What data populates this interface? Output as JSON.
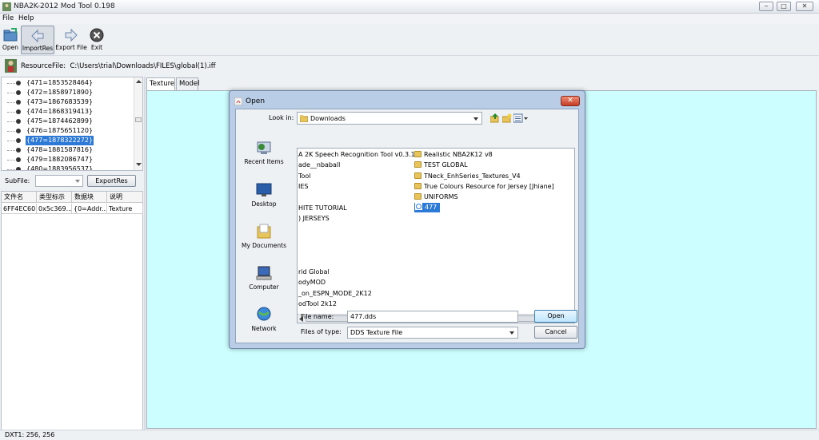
{
  "window": {
    "title": "NBA2K-2012 Mod Tool 0.198",
    "minimize": "‒",
    "maximize": "□",
    "close": "✕"
  },
  "menu": [
    "File",
    "Help"
  ],
  "toolbar": {
    "open": "Open",
    "import": "ImportRes",
    "export": "Export File",
    "exit": "Exit"
  },
  "resource": {
    "label": "ResourceFile:",
    "path": "C:\\Users\\trial\\Downloads\\FILES\\global(1).iff"
  },
  "tree": {
    "items": [
      "{471=1853528464}",
      "{472=1858971890}",
      "{473=1867683539}",
      "{474=1868319413}",
      "{475=1874462899}",
      "{476=1875651120}",
      "{477=1878322272}",
      "{478=1881587816}",
      "{479=1882086747}",
      "{480=1883956537}"
    ],
    "selected_index": 6
  },
  "subfile": {
    "label": "SubFile:",
    "export_button": "ExportRes"
  },
  "table": {
    "headers": [
      "文件名",
      "类型标示",
      "数据块",
      "说明"
    ],
    "row": [
      "6FF4EC60",
      "0x5c369...",
      "{0=Addr...",
      "Texture"
    ]
  },
  "tabs": [
    "Texture",
    "Model"
  ],
  "status": "DXT1: 256, 256",
  "colors": {
    "canvas": "#ccfeff",
    "selection": "#2d79d8"
  },
  "dialog": {
    "title": "Open",
    "look_in_label": "Look in:",
    "look_in_value": "Downloads",
    "places": [
      "Recent Items",
      "Desktop",
      "My Documents",
      "Computer",
      "Network"
    ],
    "files_left": [
      "A 2K Speech Recognition Tool v0.3.1",
      "ade__nbaball",
      "Tool",
      "IES",
      "HITE TUTORIAL",
      ") JERSEYS",
      "rid Global",
      "odyMOD",
      "_on_ESPN_MODE_2K12",
      "odTool 2k12"
    ],
    "files_right": [
      "Realistic NBA2K12 v8",
      "TEST GLOBAL",
      "TNeck_EnhSeries_Textures_V4",
      "True Colours Resource for Jersey [Jhiane]",
      "UNIFORMS",
      "477"
    ],
    "file_name_label": "File name:",
    "file_name_value": "477.dds",
    "file_type_label": "Files of type:",
    "file_type_value": "DDS Texture File",
    "open_button": "Open",
    "cancel_button": "Cancel",
    "scroll_grip": "III"
  }
}
